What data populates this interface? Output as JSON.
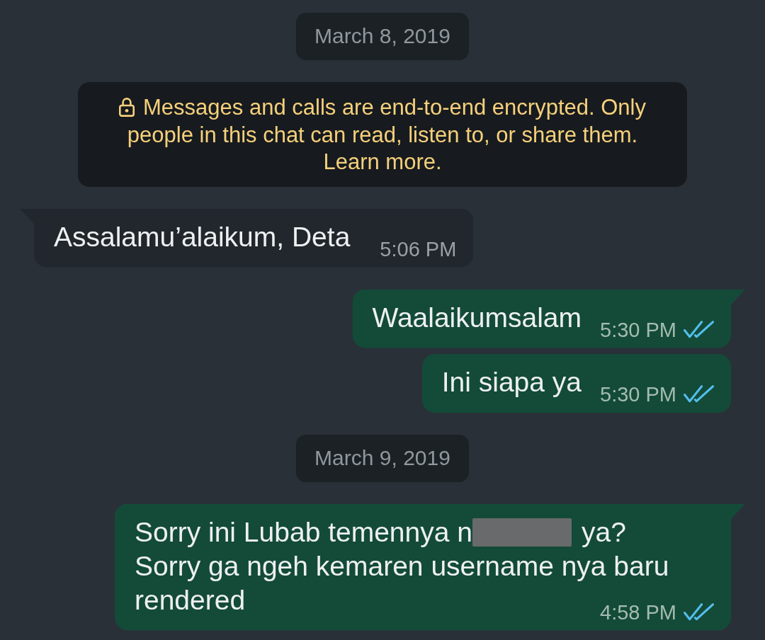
{
  "chat": [
    {
      "kind": "date",
      "text": "March 8, 2019"
    },
    {
      "kind": "notice",
      "text": "Messages and calls are end-to-end encrypted. Only people in this chat can read, listen to, or share them.",
      "link": "Learn more."
    },
    {
      "kind": "incoming",
      "tail": true,
      "lines": [
        [
          {
            "kind": "text",
            "text": "Assalamu’alaikum, Deta"
          }
        ]
      ],
      "time": "5:06 PM"
    },
    {
      "kind": "outgoing",
      "tail": true,
      "lines": [
        [
          {
            "kind": "text",
            "text": "Waalaikumsalam"
          }
        ]
      ],
      "time": "5:30 PM",
      "read": true
    },
    {
      "kind": "outgoing",
      "tail": false,
      "lines": [
        [
          {
            "kind": "text",
            "text": "Ini siapa ya"
          }
        ]
      ],
      "time": "5:30 PM",
      "read": true
    },
    {
      "kind": "date",
      "text": "March 9, 2019"
    },
    {
      "kind": "outgoing",
      "tail": true,
      "lines": [
        [
          {
            "kind": "text",
            "text": "Sorry ini Lubab temennya n"
          },
          {
            "kind": "redaction"
          },
          {
            "kind": "text",
            "text": "ya?"
          }
        ],
        [
          {
            "kind": "text",
            "text": "Sorry ga ngeh kemaren username nya baru"
          }
        ],
        [
          {
            "kind": "text",
            "text": "rendered"
          }
        ]
      ],
      "time": "4:58 PM",
      "read": true
    }
  ]
}
